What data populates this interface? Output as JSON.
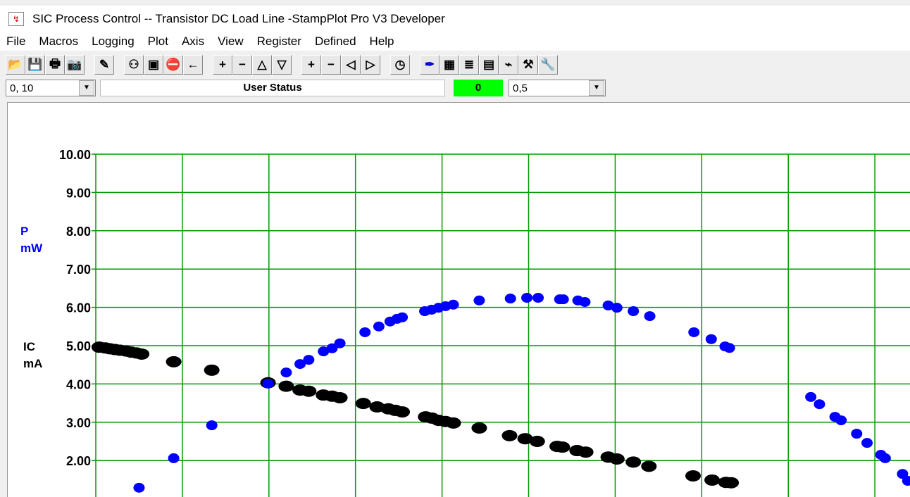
{
  "window": {
    "title": "SIC Process Control -- Transistor DC Load Line -StampPlot Pro V3 Developer"
  },
  "menu": [
    "File",
    "Macros",
    "Logging",
    "Plot",
    "Axis",
    "View",
    "Register",
    "Defined",
    "Help"
  ],
  "toolbar": {
    "icons": [
      "open-folder",
      "save",
      "print",
      "camera",
      "wand",
      "connect",
      "plot-window",
      "stop",
      "back-arrow",
      "zoom-in-y",
      "zoom-out-y",
      "up",
      "down",
      "zoom-in-x",
      "zoom-out-x",
      "left",
      "right",
      "clock",
      "pen",
      "data-table",
      "notes",
      "calculator",
      "probe",
      "tools",
      "wrench"
    ],
    "glyphs": [
      "📂",
      "💾",
      "🖶",
      "📷",
      "✎",
      "⚇",
      "▣",
      "⛔",
      "←",
      "+",
      "−",
      "△",
      "▽",
      "+",
      "−",
      "◁",
      "▷",
      "◷",
      "✒",
      "▦",
      "≣",
      "▤",
      "⌁",
      "⚒",
      "🔧"
    ]
  },
  "row2": {
    "span_select": "0, 10",
    "user_status": "User Status",
    "counter": "0",
    "max_select": "0,5"
  },
  "colors": {
    "grid": "#009900",
    "ic": "#000000",
    "p": "#0000ff",
    "counter_bg": "#00ff00"
  },
  "chart_data": {
    "type": "scatter",
    "ylim": [
      0,
      10
    ],
    "xlim": [
      0,
      9.3
    ],
    "grid": true,
    "y_ticks": [
      "10.00",
      "9.00",
      "8.00",
      "7.00",
      "6.00",
      "5.00",
      "4.00",
      "3.00",
      "2.00"
    ],
    "y_tick_values": [
      10,
      9,
      8,
      7,
      6,
      5,
      4,
      3,
      2
    ],
    "axis_labels": {
      "p": [
        "P",
        "mW"
      ],
      "ic": [
        "IC",
        "mA"
      ]
    },
    "series": [
      {
        "name": "IC mA",
        "color": "#000000",
        "points": [
          [
            0.04,
            4.96
          ],
          [
            0.11,
            4.94
          ],
          [
            0.16,
            4.92
          ],
          [
            0.22,
            4.9
          ],
          [
            0.28,
            4.88
          ],
          [
            0.35,
            4.86
          ],
          [
            0.41,
            4.83
          ],
          [
            0.47,
            4.81
          ],
          [
            0.53,
            4.78
          ],
          [
            0.9,
            4.58
          ],
          [
            1.34,
            4.36
          ],
          [
            1.99,
            4.03
          ],
          [
            2.2,
            3.94
          ],
          [
            2.36,
            3.84
          ],
          [
            2.46,
            3.81
          ],
          [
            2.63,
            3.71
          ],
          [
            2.73,
            3.68
          ],
          [
            2.82,
            3.64
          ],
          [
            3.09,
            3.49
          ],
          [
            3.25,
            3.4
          ],
          [
            3.38,
            3.35
          ],
          [
            3.46,
            3.31
          ],
          [
            3.54,
            3.27
          ],
          [
            3.81,
            3.14
          ],
          [
            3.88,
            3.11
          ],
          [
            3.96,
            3.05
          ],
          [
            4.04,
            3.02
          ],
          [
            4.13,
            2.98
          ],
          [
            4.43,
            2.85
          ],
          [
            4.78,
            2.65
          ],
          [
            4.96,
            2.57
          ],
          [
            5.1,
            2.5
          ],
          [
            5.33,
            2.37
          ],
          [
            5.39,
            2.35
          ],
          [
            5.56,
            2.26
          ],
          [
            5.66,
            2.22
          ],
          [
            5.92,
            2.09
          ],
          [
            6.02,
            2.04
          ],
          [
            6.21,
            1.96
          ],
          [
            6.39,
            1.85
          ],
          [
            6.9,
            1.6
          ],
          [
            7.12,
            1.49
          ],
          [
            7.28,
            1.43
          ],
          [
            7.34,
            1.42
          ]
        ]
      },
      {
        "name": "P mW",
        "color": "#0000ff",
        "points": [
          [
            0.5,
            1.29
          ],
          [
            0.9,
            2.06
          ],
          [
            1.34,
            2.92
          ],
          [
            1.99,
            4.01
          ],
          [
            2.2,
            4.3
          ],
          [
            2.36,
            4.52
          ],
          [
            2.46,
            4.63
          ],
          [
            2.63,
            4.85
          ],
          [
            2.73,
            4.93
          ],
          [
            2.82,
            5.06
          ],
          [
            3.11,
            5.35
          ],
          [
            3.27,
            5.5
          ],
          [
            3.4,
            5.63
          ],
          [
            3.48,
            5.7
          ],
          [
            3.54,
            5.74
          ],
          [
            3.8,
            5.9
          ],
          [
            3.88,
            5.94
          ],
          [
            3.96,
            5.99
          ],
          [
            4.04,
            6.03
          ],
          [
            4.13,
            6.07
          ],
          [
            4.43,
            6.18
          ],
          [
            4.79,
            6.23
          ],
          [
            4.98,
            6.25
          ],
          [
            5.11,
            6.25
          ],
          [
            5.36,
            6.21
          ],
          [
            5.4,
            6.21
          ],
          [
            5.57,
            6.18
          ],
          [
            5.65,
            6.14
          ],
          [
            5.92,
            6.05
          ],
          [
            6.02,
            5.99
          ],
          [
            6.21,
            5.9
          ],
          [
            6.4,
            5.77
          ],
          [
            6.91,
            5.35
          ],
          [
            7.11,
            5.17
          ],
          [
            7.27,
            4.98
          ],
          [
            7.32,
            4.94
          ],
          [
            8.26,
            3.66
          ],
          [
            8.36,
            3.47
          ],
          [
            8.54,
            3.14
          ],
          [
            8.61,
            3.05
          ],
          [
            8.79,
            2.7
          ],
          [
            8.91,
            2.46
          ],
          [
            9.07,
            2.15
          ],
          [
            9.12,
            2.06
          ],
          [
            9.32,
            1.65
          ],
          [
            9.38,
            1.47
          ]
        ]
      }
    ]
  }
}
